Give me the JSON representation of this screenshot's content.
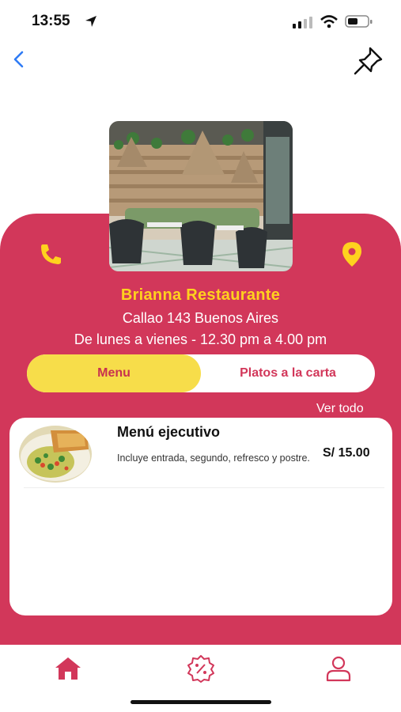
{
  "status_bar": {
    "time": "13:55"
  },
  "restaurant": {
    "name": "Brianna Restaurante",
    "address": "Callao 143 Buenos Aires",
    "hours": "De lunes a vienes - 12.30 pm a 4.00 pm"
  },
  "tabs": [
    {
      "label": "Menu",
      "active": true
    },
    {
      "label": "Platos a la carta",
      "active": false
    }
  ],
  "see_all_label": "Ver todo",
  "menu_items": [
    {
      "title": "Menú ejecutivo",
      "description": "Incluye entrada, segundo, refresco y postre.",
      "price": "S/ 15.00"
    }
  ],
  "colors": {
    "accent": "#d2375a",
    "highlight": "#f7dd4a",
    "title_yellow": "#ffd21e",
    "back_blue": "#2f7bf5"
  },
  "icons": [
    "back-icon",
    "pin-icon",
    "phone-icon",
    "location-icon",
    "home-icon",
    "promo-icon",
    "user-icon"
  ]
}
